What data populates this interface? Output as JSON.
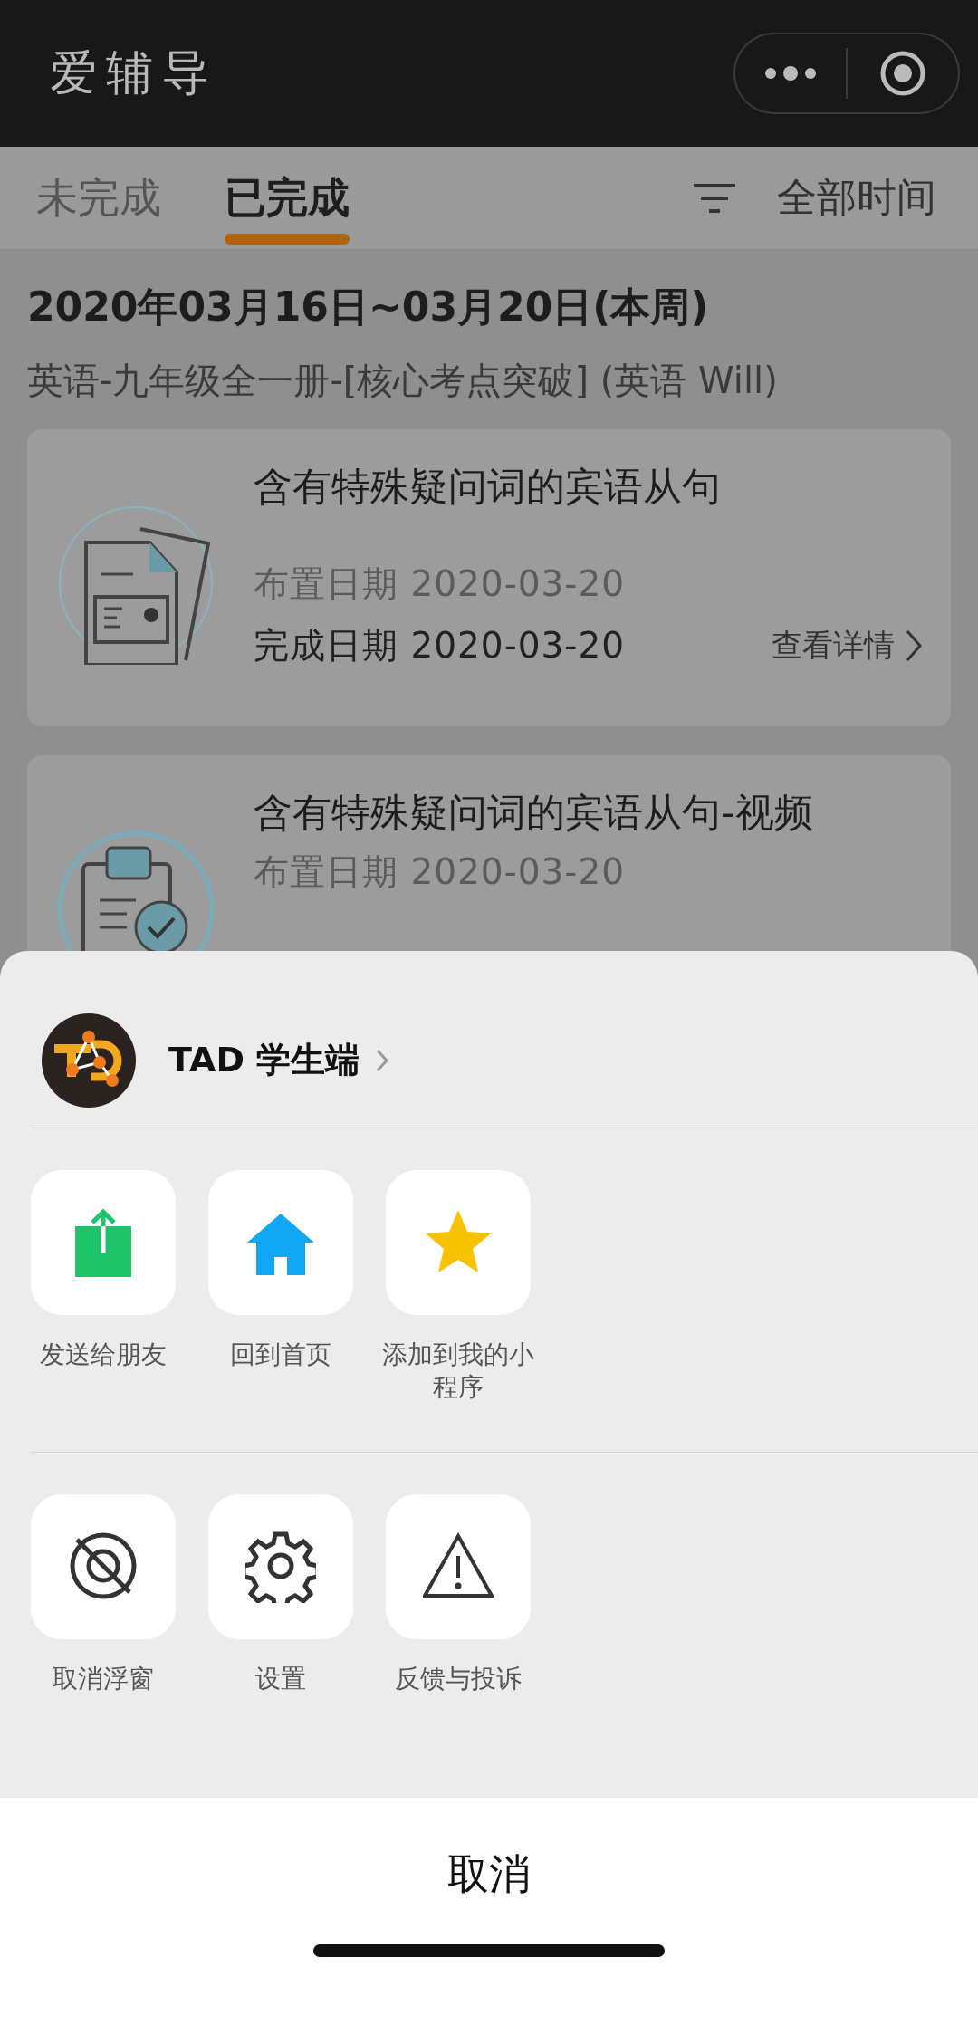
{
  "header": {
    "title": "爱辅导"
  },
  "tabs": [
    {
      "label": "未完成",
      "selected": false
    },
    {
      "label": "已完成",
      "selected": true
    }
  ],
  "filter": {
    "label": "全部时间"
  },
  "week": {
    "heading": "2020年03月16日~03月20日(本周)",
    "course": "英语-九年级全一册-[核心考点突破] (英语 Will)"
  },
  "tasks": [
    {
      "kind": "document",
      "title": "含有特殊疑问词的宾语从句",
      "assigned": "布置日期 2020-03-20",
      "completed": "完成日期 2020-03-20",
      "detail": "查看详情"
    },
    {
      "kind": "clipboard",
      "title": "含有特殊疑问词的宾语从句-视频",
      "assigned": "布置日期 2020-03-20"
    }
  ],
  "sheet": {
    "app_name": "TAD 学生端",
    "rows": [
      [
        {
          "kind": "share",
          "label": "发送给朋友"
        },
        {
          "kind": "home",
          "label": "回到首页"
        },
        {
          "kind": "star",
          "label": "添加到我的小程序"
        }
      ],
      [
        {
          "kind": "float",
          "label": "取消浮窗"
        },
        {
          "kind": "settings",
          "label": "设置"
        },
        {
          "kind": "warning",
          "label": "反馈与投诉"
        }
      ]
    ],
    "cancel": "取消"
  }
}
